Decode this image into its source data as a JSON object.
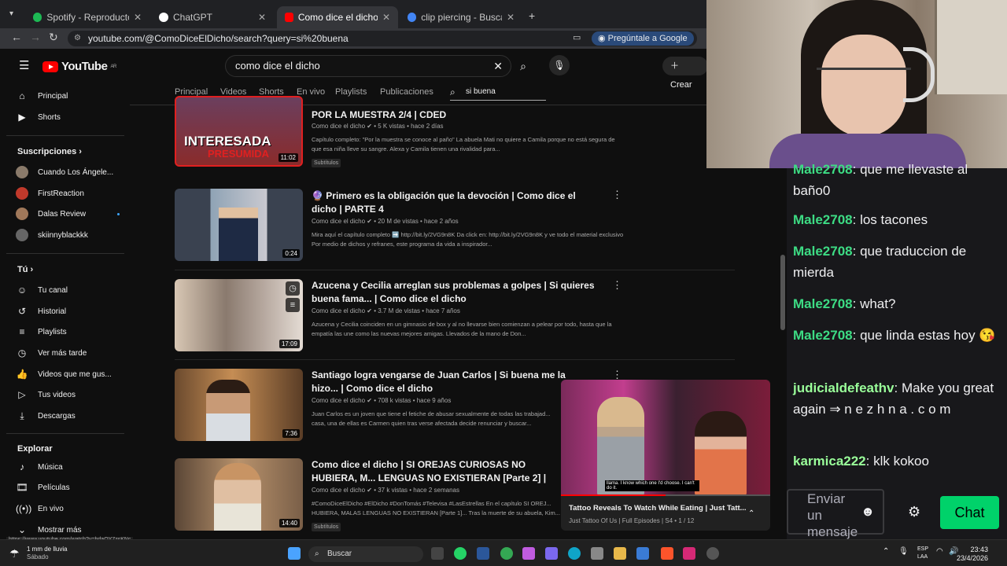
{
  "browser": {
    "tabs": [
      {
        "label": "Spotify - Reproductor web: mú",
        "color": "#1db954",
        "active": false
      },
      {
        "label": "ChatGPT",
        "color": "#ffffff",
        "active": false
      },
      {
        "label": "Como dice el dicho - YouTube",
        "color": "#ff0000",
        "active": true
      },
      {
        "label": "clip piercing - Buscar con Goog",
        "color": "#4285f4",
        "active": false
      }
    ],
    "new_tab": "+",
    "url": "youtube.com/@ComoDiceElDicho/search?query=si%20buena",
    "google_button": "Pregúntale a Google"
  },
  "youtube": {
    "logo": "YouTube",
    "logo_region": "AR",
    "search_value": "como dice el dicho",
    "create_label": "Crear",
    "channel_tabs": [
      "Principal",
      "Videos",
      "Shorts",
      "En vivo",
      "Playlists",
      "Publicaciones"
    ],
    "channel_search": "si buena"
  },
  "sidebar": {
    "main": [
      {
        "label": "Principal",
        "icon": "home-icon"
      },
      {
        "label": "Shorts",
        "icon": "shorts-icon"
      }
    ],
    "subs_heading": "Suscripciones",
    "subs": [
      {
        "label": "Cuando Los Ángele...",
        "color": "#8a7a6a"
      },
      {
        "label": "FirstReaction",
        "color": "#c0392b"
      },
      {
        "label": "Dalas Review",
        "color": "#a0785a"
      },
      {
        "label": "skiinnyblackkk",
        "color": "#666666"
      }
    ],
    "you_heading": "Tú",
    "you": [
      {
        "label": "Tu canal",
        "icon": "channel-icon"
      },
      {
        "label": "Historial",
        "icon": "history-icon"
      },
      {
        "label": "Playlists",
        "icon": "playlist-icon"
      },
      {
        "label": "Ver más tarde",
        "icon": "watch-later-icon"
      },
      {
        "label": "Videos que me gus...",
        "icon": "like-icon"
      },
      {
        "label": "Tus videos",
        "icon": "your-videos-icon"
      },
      {
        "label": "Descargas",
        "icon": "download-icon"
      }
    ],
    "explore_heading": "Explorar",
    "explore": [
      {
        "label": "Música",
        "icon": "music-icon"
      },
      {
        "label": "Películas",
        "icon": "movies-icon"
      },
      {
        "label": "En vivo",
        "icon": "live-icon"
      },
      {
        "label": "Mostrar más",
        "icon": "chevron-down-icon"
      }
    ]
  },
  "videos": [
    {
      "title": "POR LA MUESTRA 2/4 | CDED",
      "channel": "Como dice el dicho",
      "stats": "5 K vistas • hace 2 días",
      "desc": "Capítulo completo: \"Por la muestra se conoce al paño\" La abuela Mati no quiere a Camila porque no está segura de que esa niña lleve su sangre. Alexa y Camila tienen una rivalidad para...",
      "duration": "11:02",
      "badge": "Subtítulos",
      "thumb_text": "INTERESADA",
      "thumb_text2": "PRESUMIDA"
    },
    {
      "title": "🔮 Primero es la obligación que la devoción | Como dice el dicho | PARTE 4",
      "channel": "Como dice el dicho",
      "stats": "20 M de vistas • hace 2 años",
      "desc": "Mira aquí el capítulo completo ➡️ http://bit.ly/2VG9n8K Da click en: http://bit.ly/2VG9n8K y ve todo el material exclusivo Por medio de dichos y refranes, este programa da vida a inspirador...",
      "duration": "0:24"
    },
    {
      "title": "Azucena y Cecilia arreglan sus problemas a golpes | Si quieres buena fama... | Como dice el dicho",
      "channel": "Como dice el dicho",
      "stats": "3.7 M de vistas • hace 7 años",
      "desc": "Azucena y Cecilia coinciden en un gimnasio de box y al no llevarse bien comienzan a pelear por todo, hasta que la empatía las une como las nuevas mejores amigas. Llevados de la mano de Don...",
      "duration": "17:09"
    },
    {
      "title": "Santiago logra vengarse de Juan Carlos | Si buena me la hizo... | Como dice el dicho",
      "channel": "Como dice el dicho",
      "stats": "708 k vistas • hace 9 años",
      "desc": "Juan Carlos es un joven que tiene el fetiche de abusar sexualmente de todas las trabajad... casa, una de ellas es Carmen quien tras verse afectada decide renunciar y buscar...",
      "duration": "7:36"
    },
    {
      "title": "Como dice el dicho | SI OREJAS CURIOSAS NO HUBIERA, M... LENGUAS NO EXISTIERAN [Parte 2] | Full HD",
      "channel": "Como dice el dicho",
      "stats": "37 k vistas • hace 2 semanas",
      "desc": "#ComoDiceElDicho #ElDicho #DonTomás #Televisa #LasEstrellas En el capítulo SI OREJ... HUBIERA, MALAS LENGUAS NO EXISTIERAN [Parte 1]... Tras la muerte de su abuela, Kim...",
      "duration": "14:40",
      "badge": "Subtítulos"
    }
  ],
  "miniplayer": {
    "title": "Tattoo Reveals To Watch While Eating | Just Tatt...",
    "subtitle": "Just Tattoo Of Us | Full Episodes | S4 • 1 / 12",
    "caption": "llama. I know which one I'd choose. I can't do it."
  },
  "status_url": "https://www.youtube.com/watch?v=bdaQY7zsKNc",
  "chat": {
    "messages": [
      {
        "user": "Male2708",
        "text": "que me llevaste al baño0"
      },
      {
        "user": "Male2708",
        "text": "los tacones"
      },
      {
        "user": "Male2708",
        "text": "que traduccion de mierda"
      },
      {
        "user": "Male2708",
        "text": "what?"
      },
      {
        "user": "Male2708",
        "text": "que linda estas hoy 😘"
      },
      {
        "user": "judicialdefeathv",
        "text": "Make you great again ⇒ n e z h n a . c o m"
      },
      {
        "user": "karmica222",
        "text": "klk kokoo"
      }
    ],
    "input_placeholder": "Enviar un mensaje",
    "send_label": "Chat"
  },
  "taskbar": {
    "weather_line1": "1 mm de lluvia",
    "weather_line2": "Sábado",
    "search_label": "Buscar",
    "lang1": "ESP",
    "lang2": "LAA",
    "time": "23:43",
    "date": "23/4/2026"
  }
}
